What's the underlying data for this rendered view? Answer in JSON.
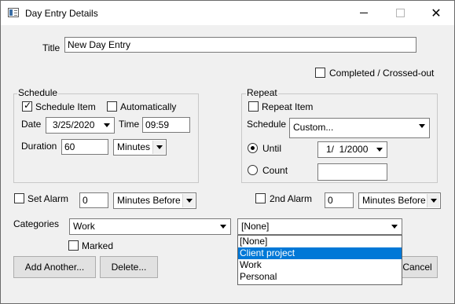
{
  "window": {
    "title": "Day Entry Details",
    "close_glyph": "✕"
  },
  "title_field": {
    "label": "Title",
    "value": "New Day Entry"
  },
  "completed": {
    "label": "Completed / Crossed-out",
    "checked": false
  },
  "schedule": {
    "group_label": "Schedule",
    "schedule_item": {
      "label": "Schedule Item",
      "checked": true
    },
    "automatically": {
      "label": "Automatically",
      "checked": false
    },
    "date_label": "Date",
    "date_value": "3/25/2020",
    "time_label": "Time",
    "time_value": "09:59",
    "duration_label": "Duration",
    "duration_value": "60",
    "duration_unit": "Minutes"
  },
  "repeat": {
    "group_label": "Repeat",
    "repeat_item": {
      "label": "Repeat Item",
      "checked": false
    },
    "schedule_label": "Schedule",
    "schedule_value": "Custom...",
    "until": {
      "label": "Until",
      "selected": true,
      "value": "1/  1/2000"
    },
    "count": {
      "label": "Count",
      "selected": false,
      "value": ""
    }
  },
  "alarm": {
    "label": "Set Alarm",
    "checked": false,
    "value": "0",
    "unit": "Minutes Before"
  },
  "alarm2": {
    "label": "2nd Alarm",
    "checked": false,
    "value": "0",
    "unit": "Minutes Before"
  },
  "categories": {
    "label": "Categories",
    "primary_value": "Work",
    "secondary_value": "[None]",
    "options": [
      "[None]",
      "Client project",
      "Work",
      "Personal"
    ],
    "highlighted_index": 1
  },
  "marked": {
    "label": "Marked",
    "checked": false
  },
  "buttons": {
    "add_another": "Add Another...",
    "delete": "Delete...",
    "cancel": "Cancel"
  },
  "colors": {
    "selection": "#0078d7",
    "background": "#f0f0f0"
  }
}
